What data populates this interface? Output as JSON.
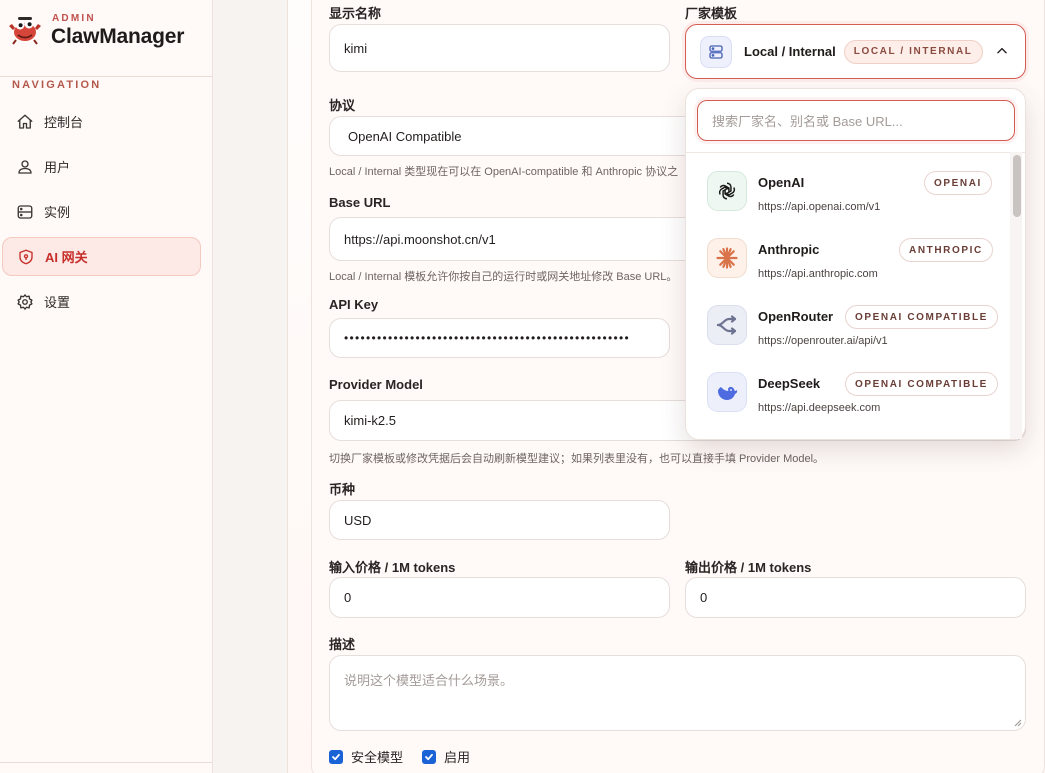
{
  "brand": {
    "admin": "ADMIN",
    "name": "ClawManager"
  },
  "nav": {
    "title": "NAVIGATION",
    "items": [
      {
        "label": "控制台",
        "icon": "home-icon"
      },
      {
        "label": "用户",
        "icon": "users-icon"
      },
      {
        "label": "实例",
        "icon": "server-icon"
      },
      {
        "label": "AI 网关",
        "icon": "shield-icon",
        "active": true
      },
      {
        "label": "设置",
        "icon": "gear-icon"
      }
    ]
  },
  "form": {
    "display_name": {
      "label": "显示名称",
      "value": "kimi"
    },
    "vendor_template": {
      "label": "厂家模板",
      "selected": "Local / Internal",
      "selected_badge": "LOCAL / INTERNAL"
    },
    "protocol": {
      "label": "协议",
      "value": "OpenAI Compatible",
      "hint": "Local / Internal 类型现在可以在 OpenAI-compatible 和 Anthropic 协议之"
    },
    "base_url": {
      "label": "Base URL",
      "value": "https://api.moonshot.cn/v1",
      "hint": "Local / Internal 模板允许你按自己的运行时或网关地址修改 Base URL。"
    },
    "api_key": {
      "label": "API Key",
      "value": "••••••••••••••••••••••••••••••••••••••••••••••••••••"
    },
    "provider_model": {
      "label": "Provider Model",
      "value": "kimi-k2.5",
      "hint": "切换厂家模板或修改凭据后会自动刷新模型建议；如果列表里没有，也可以直接手填 Provider Model。"
    },
    "currency": {
      "label": "币种",
      "value": "USD"
    },
    "input_price": {
      "label": "输入价格 / 1M tokens",
      "value": "0"
    },
    "output_price": {
      "label": "输出价格 / 1M tokens",
      "value": "0"
    },
    "description": {
      "label": "描述",
      "placeholder": "说明这个模型适合什么场景。"
    },
    "checkboxes": [
      {
        "label": "安全模型",
        "checked": true
      },
      {
        "label": "启用",
        "checked": true
      }
    ]
  },
  "dropdown": {
    "search_placeholder": "搜索厂家名、别名或 Base URL...",
    "items": [
      {
        "name": "OpenAI",
        "badge": "OPENAI",
        "url": "https://api.openai.com/v1",
        "icon": "openai-logo-icon"
      },
      {
        "name": "Anthropic",
        "badge": "ANTHROPIC",
        "url": "https://api.anthropic.com",
        "icon": "anthropic-logo-icon"
      },
      {
        "name": "OpenRouter",
        "badge": "OPENAI COMPATIBLE",
        "url": "https://openrouter.ai/api/v1",
        "icon": "openrouter-logo-icon"
      },
      {
        "name": "DeepSeek",
        "badge": "OPENAI COMPATIBLE",
        "url": "https://api.deepseek.com",
        "icon": "deepseek-logo-icon"
      }
    ]
  },
  "colors": {
    "accent": "#d45c55",
    "active_nav_bg": "#fde9e5",
    "active_nav_text": "#c62f2a",
    "checkbox": "#1a63d6"
  }
}
